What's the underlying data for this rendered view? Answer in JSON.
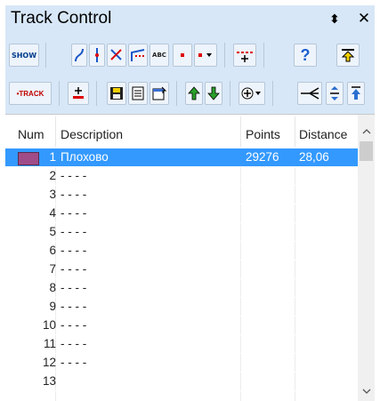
{
  "window": {
    "title": "Track Control",
    "pin_glyph": "⬍",
    "close_glyph": "✕"
  },
  "toolbar": {
    "show_label": "SHOW",
    "track_label": "•TRACK",
    "abc_label": "ABC",
    "help_label": "?",
    "row1_icons": [
      "show-icon",
      "curve-icon",
      "split-icon",
      "arrow-icon",
      "path-icon",
      "abc-icon",
      "dot-icon",
      "dot-dropdown-icon",
      "add-point-icon",
      "help-icon",
      "upload-icon"
    ],
    "row2_icons": [
      "track-icon",
      "track-edit-icon",
      "save-icon",
      "list-icon",
      "properties-icon",
      "move-up-icon",
      "move-down-icon",
      "add-dropdown-icon",
      "join-icon",
      "insert-icon",
      "move-top-icon"
    ]
  },
  "table": {
    "columns": [
      "Num",
      "Description",
      "Points",
      "Distance"
    ],
    "rows": [
      {
        "num": "1",
        "desc": "Плохово",
        "points": "29276",
        "distance": "28,06",
        "selected": true,
        "color": "#a04c88"
      },
      {
        "num": "2",
        "desc": "- - - -",
        "points": "",
        "distance": ""
      },
      {
        "num": "3",
        "desc": "- - - -",
        "points": "",
        "distance": ""
      },
      {
        "num": "4",
        "desc": "- - - -",
        "points": "",
        "distance": ""
      },
      {
        "num": "5",
        "desc": "- - - -",
        "points": "",
        "distance": ""
      },
      {
        "num": "6",
        "desc": "- - - -",
        "points": "",
        "distance": ""
      },
      {
        "num": "7",
        "desc": "- - - -",
        "points": "",
        "distance": ""
      },
      {
        "num": "8",
        "desc": "- - - -",
        "points": "",
        "distance": ""
      },
      {
        "num": "9",
        "desc": "- - - -",
        "points": "",
        "distance": ""
      },
      {
        "num": "10",
        "desc": "- - - -",
        "points": "",
        "distance": ""
      },
      {
        "num": "11",
        "desc": "- - - -",
        "points": "",
        "distance": ""
      },
      {
        "num": "12",
        "desc": "- - - -",
        "points": "",
        "distance": ""
      },
      {
        "num": "13",
        "desc": "",
        "points": "",
        "distance": ""
      }
    ]
  },
  "colors": {
    "title_bg": "#d7e7f7",
    "selection": "#3399ff",
    "track_color": "#a04c88"
  }
}
